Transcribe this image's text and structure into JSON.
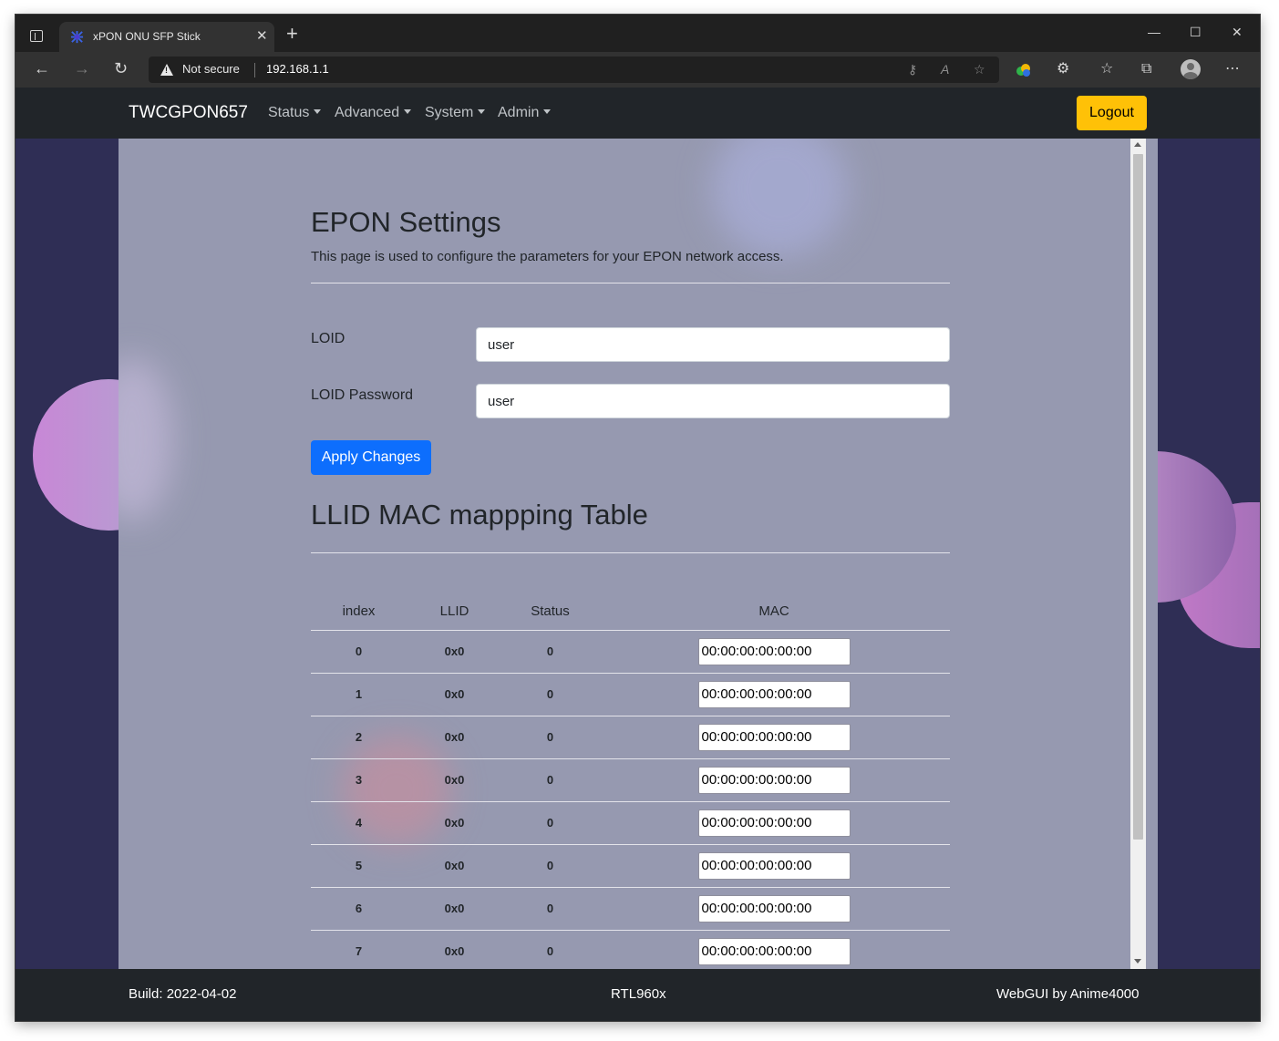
{
  "browser": {
    "tab_title": "xPON ONU SFP Stick",
    "close_glyph": "✕",
    "new_tab_glyph": "+",
    "minimize_glyph": "—",
    "maximize_glyph": "☐",
    "window_close_glyph": "✕",
    "back_glyph": "←",
    "forward_glyph": "→",
    "reload_glyph": "↻",
    "security_label": "Not secure",
    "url": "192.168.1.1",
    "key_glyph": "⚷",
    "read_aloud_glyph": "A",
    "favorite_glyph": "☆",
    "extensions_glyph": "⚙",
    "favorites_bar_glyph": "☆",
    "collections_glyph": "⧉",
    "more_glyph": "⋯"
  },
  "navbar": {
    "brand": "TWCGPON657",
    "menu": [
      "Status",
      "Advanced",
      "System",
      "Admin"
    ],
    "logout_label": "Logout"
  },
  "epon": {
    "title": "EPON Settings",
    "description": "This page is used to configure the parameters for your EPON network access.",
    "loid_label": "LOID",
    "loid_value": "user",
    "password_label": "LOID Password",
    "password_value": "user",
    "apply_label": "Apply Changes"
  },
  "llid_table": {
    "title": "LLID MAC mappping Table",
    "columns": [
      "index",
      "LLID",
      "Status",
      "MAC"
    ],
    "rows": [
      {
        "index": "0",
        "llid": "0x0",
        "status": "0",
        "mac": "00:00:00:00:00:00"
      },
      {
        "index": "1",
        "llid": "0x0",
        "status": "0",
        "mac": "00:00:00:00:00:00"
      },
      {
        "index": "2",
        "llid": "0x0",
        "status": "0",
        "mac": "00:00:00:00:00:00"
      },
      {
        "index": "3",
        "llid": "0x0",
        "status": "0",
        "mac": "00:00:00:00:00:00"
      },
      {
        "index": "4",
        "llid": "0x0",
        "status": "0",
        "mac": "00:00:00:00:00:00"
      },
      {
        "index": "5",
        "llid": "0x0",
        "status": "0",
        "mac": "00:00:00:00:00:00"
      },
      {
        "index": "6",
        "llid": "0x0",
        "status": "0",
        "mac": "00:00:00:00:00:00"
      },
      {
        "index": "7",
        "llid": "0x0",
        "status": "0",
        "mac": "00:00:00:00:00:00"
      }
    ]
  },
  "footer": {
    "build": "Build: 2022-04-02",
    "chip": "RTL960x",
    "credit": "WebGUI by Anime4000"
  },
  "colors": {
    "navbar_bg": "#212529",
    "page_bg": "#2f2e55",
    "content_bg": "#9699b0",
    "logout_bg": "#ffc107",
    "apply_bg": "#0d6efd"
  }
}
